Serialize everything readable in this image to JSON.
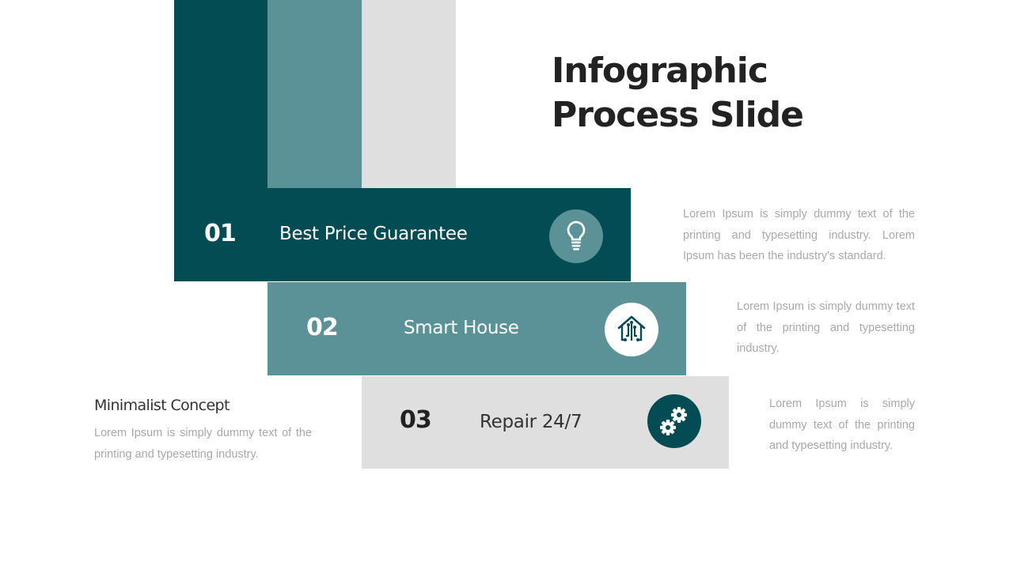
{
  "title": {
    "line1": "Infographic",
    "line2": "Process Slide"
  },
  "colors": {
    "dark_teal": "#034c54",
    "mid_teal": "#5a9298",
    "light_gray": "#dfdfdf",
    "title_text": "#222222",
    "body_text": "#a8a8a8"
  },
  "steps": [
    {
      "number": "01",
      "label": "Best Price Guarantee",
      "icon": "lightbulb-icon",
      "description": "Lorem Ipsum is simply dummy text of the printing and typesetting industry.  Lorem Ipsum has been the industry's standard."
    },
    {
      "number": "02",
      "label": "Smart House",
      "icon": "smart-house-icon",
      "description": "Lorem Ipsum is simply dummy text of the printing and typesetting industry."
    },
    {
      "number": "03",
      "label": "Repair 24/7",
      "icon": "gears-icon",
      "description": "Lorem Ipsum is simply dummy text of the printing and typesetting industry."
    }
  ],
  "concept": {
    "title": "Minimalist Concept",
    "description": "Lorem Ipsum is simply dummy text of the printing and typesetting industry."
  }
}
